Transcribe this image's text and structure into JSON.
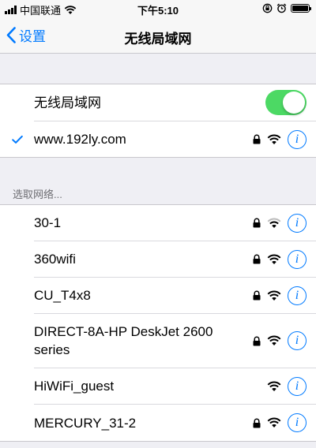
{
  "status_bar": {
    "carrier": "中国联通",
    "time": "下午5:10"
  },
  "nav": {
    "back_label": "设置",
    "title": "无线局域网"
  },
  "wifi_toggle": {
    "label": "无线局域网",
    "on": true
  },
  "connected": {
    "name": "www.192ly.com",
    "locked": true
  },
  "section_header": "选取网络...",
  "networks": [
    {
      "name": "30-1",
      "locked": true
    },
    {
      "name": "360wifi",
      "locked": true
    },
    {
      "name": "CU_T4x8",
      "locked": true
    },
    {
      "name": "DIRECT-8A-HP DeskJet 2600 series",
      "locked": true
    },
    {
      "name": "HiWiFi_guest",
      "locked": false
    },
    {
      "name": "MERCURY_31-2",
      "locked": true
    }
  ],
  "colors": {
    "accent": "#007aff",
    "toggle_on": "#4cd964"
  },
  "icons": [
    "signal-icon",
    "wifi-icon",
    "lock-icon",
    "info-icon",
    "checkmark-icon",
    "alarm-icon",
    "orientation-lock-icon",
    "battery-icon",
    "back-chevron-icon"
  ]
}
